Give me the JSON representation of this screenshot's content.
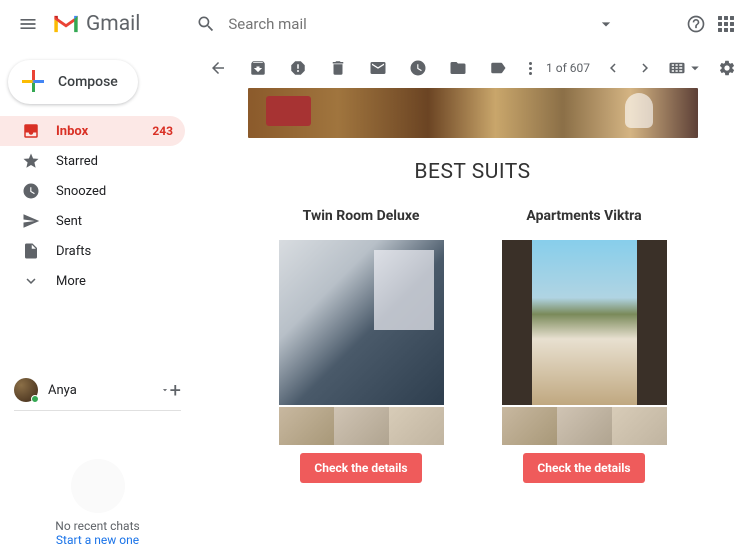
{
  "header": {
    "product": "Gmail",
    "search_placeholder": "Search mail"
  },
  "sidebar": {
    "compose": "Compose",
    "items": [
      {
        "label": "Inbox",
        "count": "243"
      },
      {
        "label": "Starred"
      },
      {
        "label": "Snoozed"
      },
      {
        "label": "Sent"
      },
      {
        "label": "Drafts"
      },
      {
        "label": "More"
      }
    ]
  },
  "hangouts": {
    "name": "Anya"
  },
  "chats": {
    "empty": "No recent chats",
    "link": "Start a new one"
  },
  "toolbar": {
    "position": "1 of 607"
  },
  "email": {
    "section_title": "BEST SUITS",
    "cards": [
      {
        "title": "Twin Room Deluxe",
        "cta": "Check the details"
      },
      {
        "title": "Apartments Viktra",
        "cta": "Check the details"
      }
    ]
  }
}
